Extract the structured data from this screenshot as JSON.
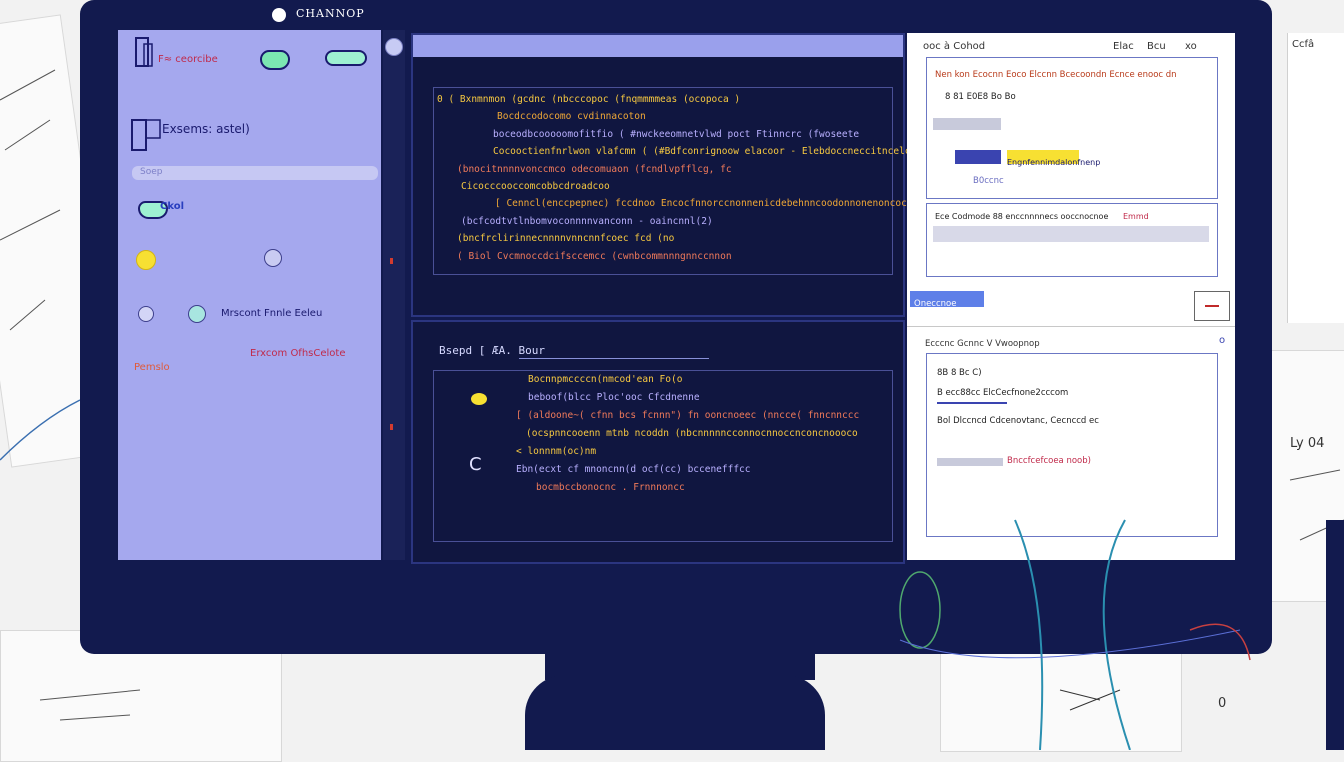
{
  "window": {
    "title": "CHANNOP"
  },
  "left_panel": {
    "header_label": "F≈ ceorcibe",
    "user_label": "Exsems: astel)",
    "search_placeholder": "Soep",
    "toggle_label": "Ckol",
    "option_label": "Mrscont Fnnle Eeleu",
    "link_label": "Erxcom OfhsCelote",
    "warning_label": "Pemslo"
  },
  "code_top": {
    "lines": [
      "0 (  Bxnmnmon (gcdnc (nbcccopoc (fnqmmmmeas (ocopoca )",
      "Bocdccodocomo cvdinnacoton",
      "boceodbcooooomofitfio  (  #nwckeeomnetvlwd poct Ftinncrc (fwoseete",
      "Cocooctienfnrlwon vlafcmn (  (#Bdfconrignoow elacoor - Elebdoccneccitncelceo",
      "(bnocitnnnnvonccmco odecomuaon  (fcndlvpfflcg, fc",
      "Cicocccooccomcobbcdroadcoo",
      "[ Cenncl(enccpepnec) fccdnoo Encocfnnorccnonnenicdebehnncoodonnonenoncoc ol",
      "(bcfcodtvtlnbomvoconnnnvanconn  -  oaincnnl(2)",
      "(bncfrclirinnecnnnnvnncnnfcoec  fcd (no",
      "( Biol Cvcmnoccdcifsccemcc (cwnbcommnnngnnccnnon"
    ]
  },
  "code_bottom": {
    "title": "Bsepd [ ÆA. Bour",
    "lines": [
      "Bocnnpmccccn(nmcod'ean   Fo(o",
      "beboof(blcc   Ploc'ooc  Cfcdnenne",
      "[ (aldoone~(  cfnn  bcs  fcnnn\")  fn  ooncnoeec (nncce( fnncnnccc",
      "(ocspnncooenn mtnb ncoddn (nbcnnnnncconnocnnoccnconcnoooco",
      "< lonnnm(oc)nm",
      "Ebn(ecxt cf  mnoncnn(d   ocf(cc)        bccenefffcc",
      "bocmbccbonocnc .                        Frnnnoncc"
    ],
    "bulb_icon": "lightbulb-icon",
    "bracket_icon": "C"
  },
  "right_panel": {
    "header": "ooc  à Cohod",
    "header_icons": [
      "Elac",
      "Bcu",
      "xo"
    ],
    "card1_title": "Nen kon Ecocnn Eoco Elccnn Bcecoondn Ecnce enooc dn",
    "card1_sub": "8 81 E0E8 Bo  Bo",
    "card1_highlight": "Engnfennimdalonfnenp",
    "card1_caption": "B0ccnc",
    "card2_title": "Ece Codmode 88  enccnnnnecs ooccnocnoe",
    "card2_tag": "Emmd",
    "tab_label": "Oneccnoe",
    "card3_header": "Ecccnc Gcnnc V  Vwoopnop",
    "card3_lines": [
      "8B 8 Bc C)",
      "B ecc88cc ElcCecfnone2cccom",
      "Bol  Dlccncd Cdcenovtanc, Cecnccd ec",
      "Bnccfcefcoea  noob)"
    ],
    "close_icon": "o"
  },
  "side_panel": {
    "label": "Ccfâ"
  },
  "sketch_labels": [
    "Ly 04",
    "0"
  ],
  "colors": {
    "monitor": "#121a4e",
    "left_panel": "#a5a8ee",
    "code_text": "#f7c941",
    "accent_blue": "#3a44b0"
  }
}
